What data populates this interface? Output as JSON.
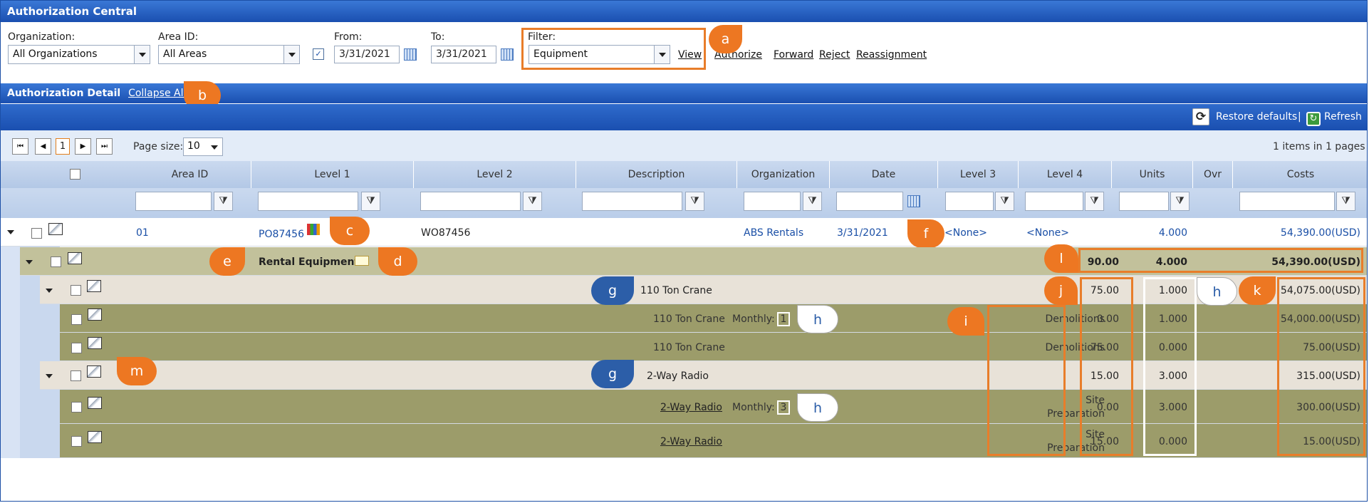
{
  "app": {
    "title": "Authorization Central"
  },
  "filters": {
    "organization": {
      "label": "Organization:",
      "value": "All Organizations"
    },
    "area_id": {
      "label": "Area ID:",
      "value": "All Areas"
    },
    "from": {
      "label": "From:",
      "value": "3/31/2021"
    },
    "to": {
      "label": "To:",
      "value": "3/31/2021"
    },
    "filter": {
      "label": "Filter:",
      "value": "Equipment"
    },
    "view_link": "View",
    "actions": [
      "Authorize",
      "Forward",
      "Reject",
      "Reassignment"
    ]
  },
  "detail": {
    "title": "Authorization Detail",
    "collapse_all": "Collapse All"
  },
  "toolbar": {
    "restore": "Restore defaults",
    "separator": "|",
    "refresh": "Refresh"
  },
  "pager": {
    "current_page": "1",
    "page_size_label": "Page size:",
    "page_size": "10",
    "summary": "1 items in 1 pages"
  },
  "columns": [
    "Area ID",
    "Level 1",
    "Level 2",
    "Description",
    "Organization",
    "Date",
    "Level 3",
    "Level 4",
    "Units",
    "Ovr",
    "Costs"
  ],
  "main_row": {
    "area_id": "01",
    "level1": "PO87456",
    "level2": "WO87456",
    "organization": "ABS Rentals",
    "date": "3/31/2021",
    "level3": "<None>",
    "level4": "<None>",
    "units": "4.000",
    "costs": "54,390.00(USD)"
  },
  "group_row": {
    "name": "Rental Equipment",
    "total1": "90.00",
    "units": "4.000",
    "costs": "54,390.00(USD)"
  },
  "sub_rows": [
    {
      "desc": "110 Ton Crane",
      "col_a": "75.00",
      "units": "1.000",
      "costs": "54,075.00(USD)"
    },
    {
      "desc": "110 Ton Crane",
      "monthly_label": "Monthly:",
      "monthly": "1",
      "level4": "Demolitions",
      "col_a": "0.00",
      "units": "1.000",
      "costs": "54,000.00(USD)"
    },
    {
      "desc": "110 Ton Crane",
      "level4": "Demolitions",
      "col_a": "75.00",
      "units": "0.000",
      "costs": "75.00(USD)"
    },
    {
      "desc": "2-Way Radio",
      "col_a": "15.00",
      "units": "3.000",
      "costs": "315.00(USD)"
    },
    {
      "desc": "2-Way Radio",
      "monthly_label": "Monthly:",
      "monthly": "3",
      "level4_a": "Site",
      "level4_b": "Preparation",
      "col_a": "0.00",
      "units": "3.000",
      "costs": "300.00(USD)"
    },
    {
      "desc": "2-Way Radio",
      "level4_a": "Site",
      "level4_b": "Preparation",
      "col_a": "15.00",
      "units": "0.000",
      "costs": "15.00(USD)"
    }
  ],
  "callouts": {
    "a": "a",
    "b": "b",
    "c": "c",
    "d": "d",
    "e": "e",
    "f": "f",
    "g": "g",
    "h": "h",
    "i": "i",
    "j": "j",
    "k": "k",
    "l": "l",
    "m": "m"
  },
  "colors": {
    "header_blue": "#1a4fb0",
    "group_olive": "#c2c19b",
    "parent_beige": "#e8e2d8",
    "child_olive": "#9c9c6a",
    "callout_orange": "#ed7722",
    "callout_blue": "#2c5ea8"
  }
}
